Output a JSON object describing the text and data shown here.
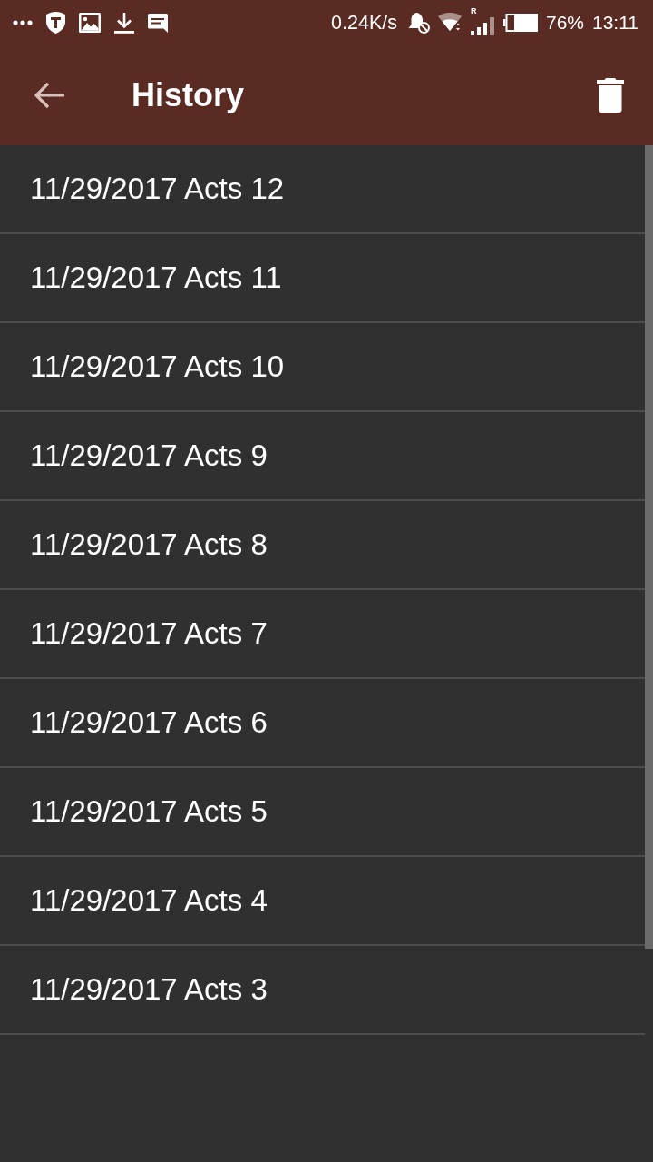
{
  "status_bar": {
    "network_speed": "0.24K/s",
    "signal_label": "R",
    "battery": "76%",
    "time": "13:11"
  },
  "toolbar": {
    "title": "History"
  },
  "history_items": [
    "11/29/2017 Acts 12",
    "11/29/2017 Acts 11",
    "11/29/2017 Acts 10",
    "11/29/2017 Acts 9",
    "11/29/2017 Acts 8",
    "11/29/2017 Acts 7",
    "11/29/2017 Acts 6",
    "11/29/2017 Acts 5",
    "11/29/2017 Acts 4",
    "11/29/2017 Acts 3"
  ]
}
